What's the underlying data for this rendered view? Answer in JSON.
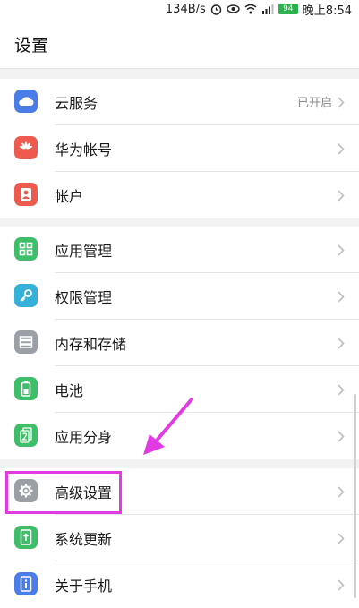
{
  "status_bar": {
    "net_speed": "134B/s",
    "battery_level": "94",
    "time": "晚上8:54",
    "icons": [
      "alarm-icon",
      "eye-icon",
      "wifi-icon",
      "signal-icon",
      "battery-icon"
    ]
  },
  "header": {
    "title": "设置"
  },
  "groups": [
    {
      "items": [
        {
          "label": "云服务",
          "value": "已开启",
          "icon": "cloud-icon",
          "color": "#4a7de8"
        },
        {
          "label": "华为帐号",
          "icon": "huawei-icon",
          "color": "#ee5a4e"
        },
        {
          "label": "帐户",
          "icon": "user-icon",
          "color": "#ee5a4e"
        }
      ]
    },
    {
      "items": [
        {
          "label": "应用管理",
          "icon": "apps-icon",
          "color": "#3fbe6a"
        },
        {
          "label": "权限管理",
          "icon": "key-icon",
          "color": "#34b0d9"
        },
        {
          "label": "内存和存储",
          "icon": "storage-icon",
          "color": "#9aa0a6"
        },
        {
          "label": "电池",
          "icon": "battery-icon",
          "color": "#3fbe6a"
        },
        {
          "label": "应用分身",
          "icon": "app-twin-icon",
          "color": "#3fbe6a"
        }
      ]
    },
    {
      "items": [
        {
          "label": "高级设置",
          "icon": "gear-icon",
          "color": "#9aa0a6"
        },
        {
          "label": "系统更新",
          "icon": "update-icon",
          "color": "#3fbe6a"
        },
        {
          "label": "关于手机",
          "icon": "info-icon",
          "color": "#4a7de8"
        }
      ]
    }
  ],
  "annotation": {
    "highlight_color": "#e23be3"
  }
}
